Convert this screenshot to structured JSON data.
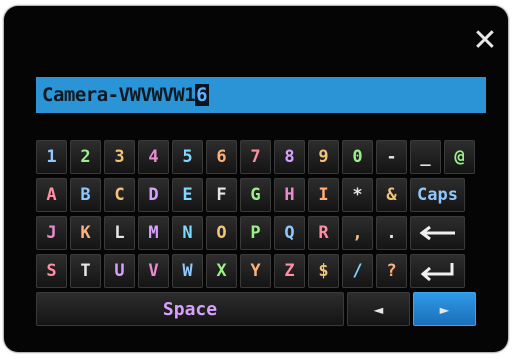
{
  "dialog": {
    "close_label": "✕",
    "input_text": "Camera-VWVWVW1",
    "caret_char": "6"
  },
  "keyboard": {
    "rows": [
      [
        "1",
        "2",
        "3",
        "4",
        "5",
        "6",
        "7",
        "8",
        "9",
        "0",
        "-",
        "_",
        "@"
      ],
      [
        "A",
        "B",
        "C",
        "D",
        "E",
        "F",
        "G",
        "H",
        "I",
        "*",
        "&",
        "Caps"
      ],
      [
        "J",
        "K",
        "L",
        "M",
        "N",
        "O",
        "P",
        "Q",
        "R",
        ",",
        ".",
        "backspace-icon"
      ],
      [
        "S",
        "T",
        "U",
        "V",
        "W",
        "X",
        "Y",
        "Z",
        "$",
        "/",
        "?",
        "enter-icon"
      ]
    ],
    "space_label": "Space",
    "left_arrow": "◄",
    "right_arrow": "►"
  }
}
